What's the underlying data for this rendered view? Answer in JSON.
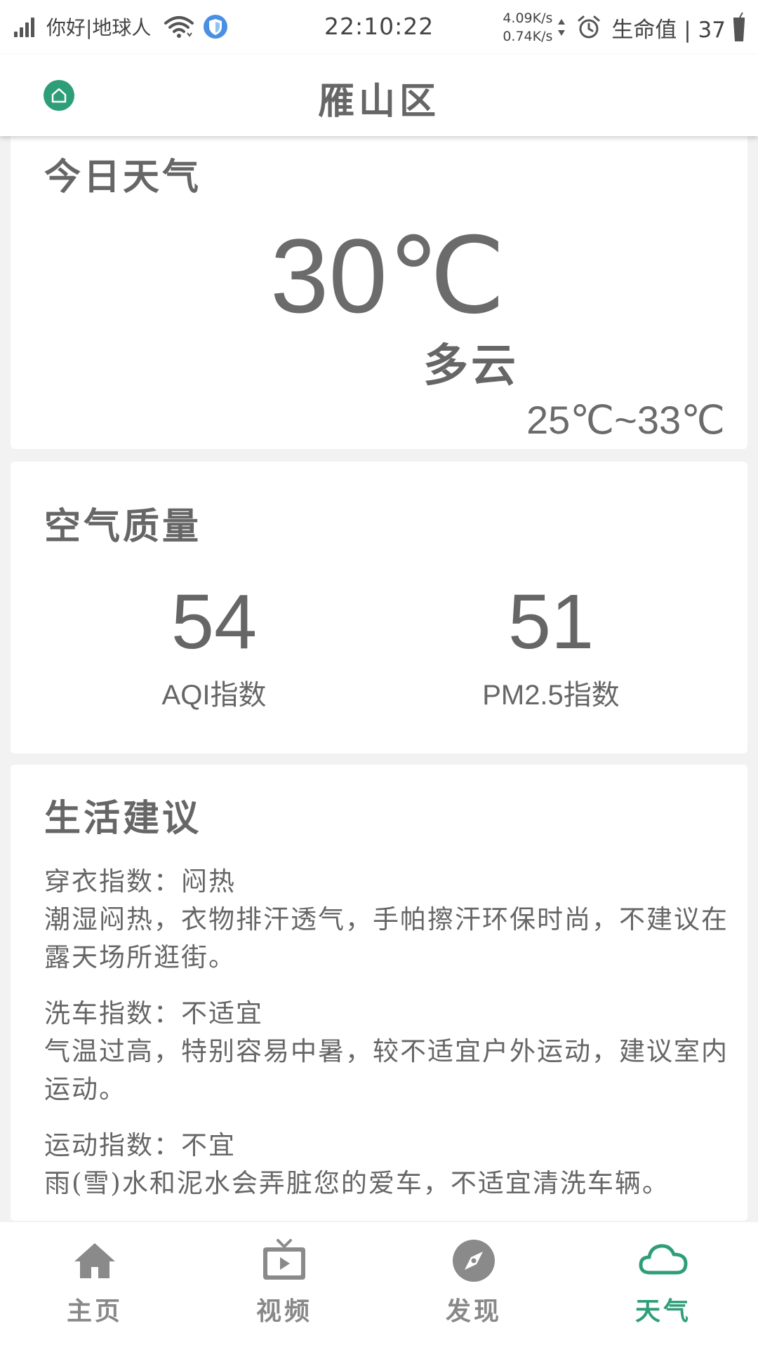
{
  "status_bar": {
    "carrier": "你好|地球人",
    "time": "22:10:22",
    "speed_up": "4.09K/s",
    "speed_down": "0.74K/s",
    "life_label": "生命值 | 37"
  },
  "header": {
    "title": "雁山区"
  },
  "weather": {
    "title": "今日天气",
    "temperature": "30℃",
    "condition": "多云",
    "range": "25℃~33℃"
  },
  "air": {
    "title": "空气质量",
    "aqi_value": "54",
    "aqi_label": "AQI指数",
    "pm_value": "51",
    "pm_label": "PM2.5指数"
  },
  "life": {
    "title": "生活建议",
    "items": [
      {
        "head": "穿衣指数：闷热",
        "text": "潮湿闷热，衣物排汗透气，手帕擦汗环保时尚，不建议在露天场所逛街。"
      },
      {
        "head": "洗车指数：不适宜",
        "text": "气温过高，特别容易中暑，较不适宜户外运动，建议室内运动。"
      },
      {
        "head": "运动指数：不宜",
        "text": "雨(雪)水和泥水会弄脏您的爱车，不适宜清洗车辆。"
      }
    ]
  },
  "nav": {
    "items": [
      {
        "label": "主页",
        "icon": "home-icon"
      },
      {
        "label": "视频",
        "icon": "tv-icon"
      },
      {
        "label": "发现",
        "icon": "compass-icon"
      },
      {
        "label": "天气",
        "icon": "cloud-icon"
      }
    ],
    "active_index": 3
  },
  "colors": {
    "accent": "#2e9e78",
    "inactive": "#888888",
    "text": "#666666",
    "background": "#f2f2f2"
  }
}
